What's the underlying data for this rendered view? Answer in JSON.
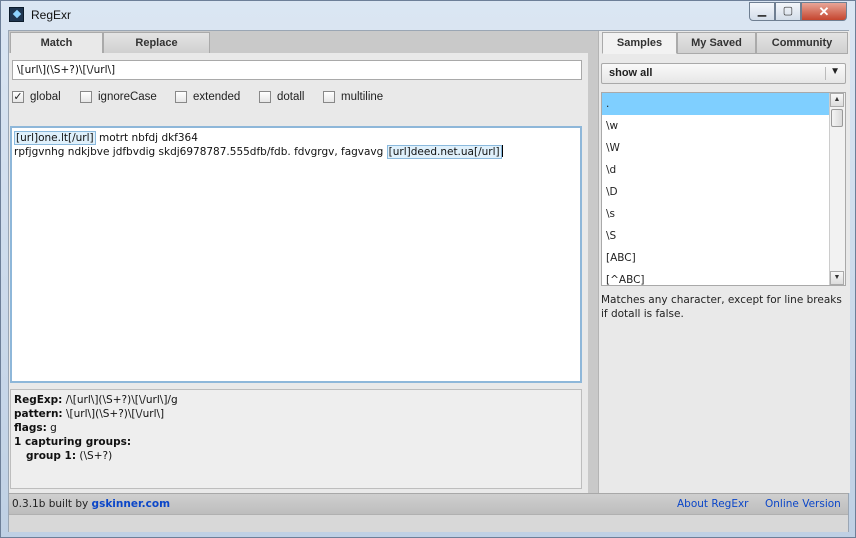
{
  "window": {
    "title": "RegExr"
  },
  "controls": {
    "minimize": "▁",
    "maximize": "▢",
    "close": "✕"
  },
  "tabs": [
    {
      "label": "Match"
    },
    {
      "label": "Replace"
    }
  ],
  "regex": {
    "value": "\\[url\\](\\S+?)\\[\\/url\\]"
  },
  "flags": [
    {
      "label": "global",
      "checked": true
    },
    {
      "label": "ignoreCase",
      "checked": false
    },
    {
      "label": "extended",
      "checked": false
    },
    {
      "label": "dotall",
      "checked": false
    },
    {
      "label": "multiline",
      "checked": false
    }
  ],
  "source_text": {
    "line1": {
      "m1": "[url]one.lt[/url]",
      "rest": " motrt nbfdj dkf364"
    },
    "line2": {
      "pre": "rpfjgvnhg ndkjbve jdfbvdig skdj6978787.555dfb/fdb. fdvgrgv, fagvavg ",
      "m2": "[url]deed.net.ua[/url]"
    }
  },
  "results": {
    "regexp_label": "RegExp:",
    "regexp_value": " /\\[url\\](\\S+?)\\[\\/url\\]/g",
    "pattern_label": "pattern:",
    "pattern_value": " \\[url\\](\\S+?)\\[\\/url\\]",
    "flags_label": "flags:",
    "flags_value": " g",
    "groups_label": "1 capturing groups:",
    "group1_label": "group 1:",
    "group1_value": " (\\S+?)"
  },
  "right_tabs": [
    {
      "label": "Samples"
    },
    {
      "label": "My Saved"
    },
    {
      "label": "Community"
    }
  ],
  "filter": {
    "value": "show all",
    "arrow": "▼"
  },
  "samples": [
    ".",
    "\\w",
    "\\W",
    "\\d",
    "\\D",
    "\\s",
    "\\S",
    "[ABC]",
    "[^ABC]"
  ],
  "sample_description": "Matches any character, except for line breaks if dotall is false.",
  "scroll": {
    "up": "▲",
    "down": "▼"
  },
  "status": {
    "version": "0.3.1b built by ",
    "author": "gskinner.com",
    "about_link": "About RegExr",
    "online_link": "Online Version"
  },
  "colors": {
    "accent": "#0b46c8",
    "selection": "#7fcfff",
    "match_highlight": "#dff0fb"
  }
}
